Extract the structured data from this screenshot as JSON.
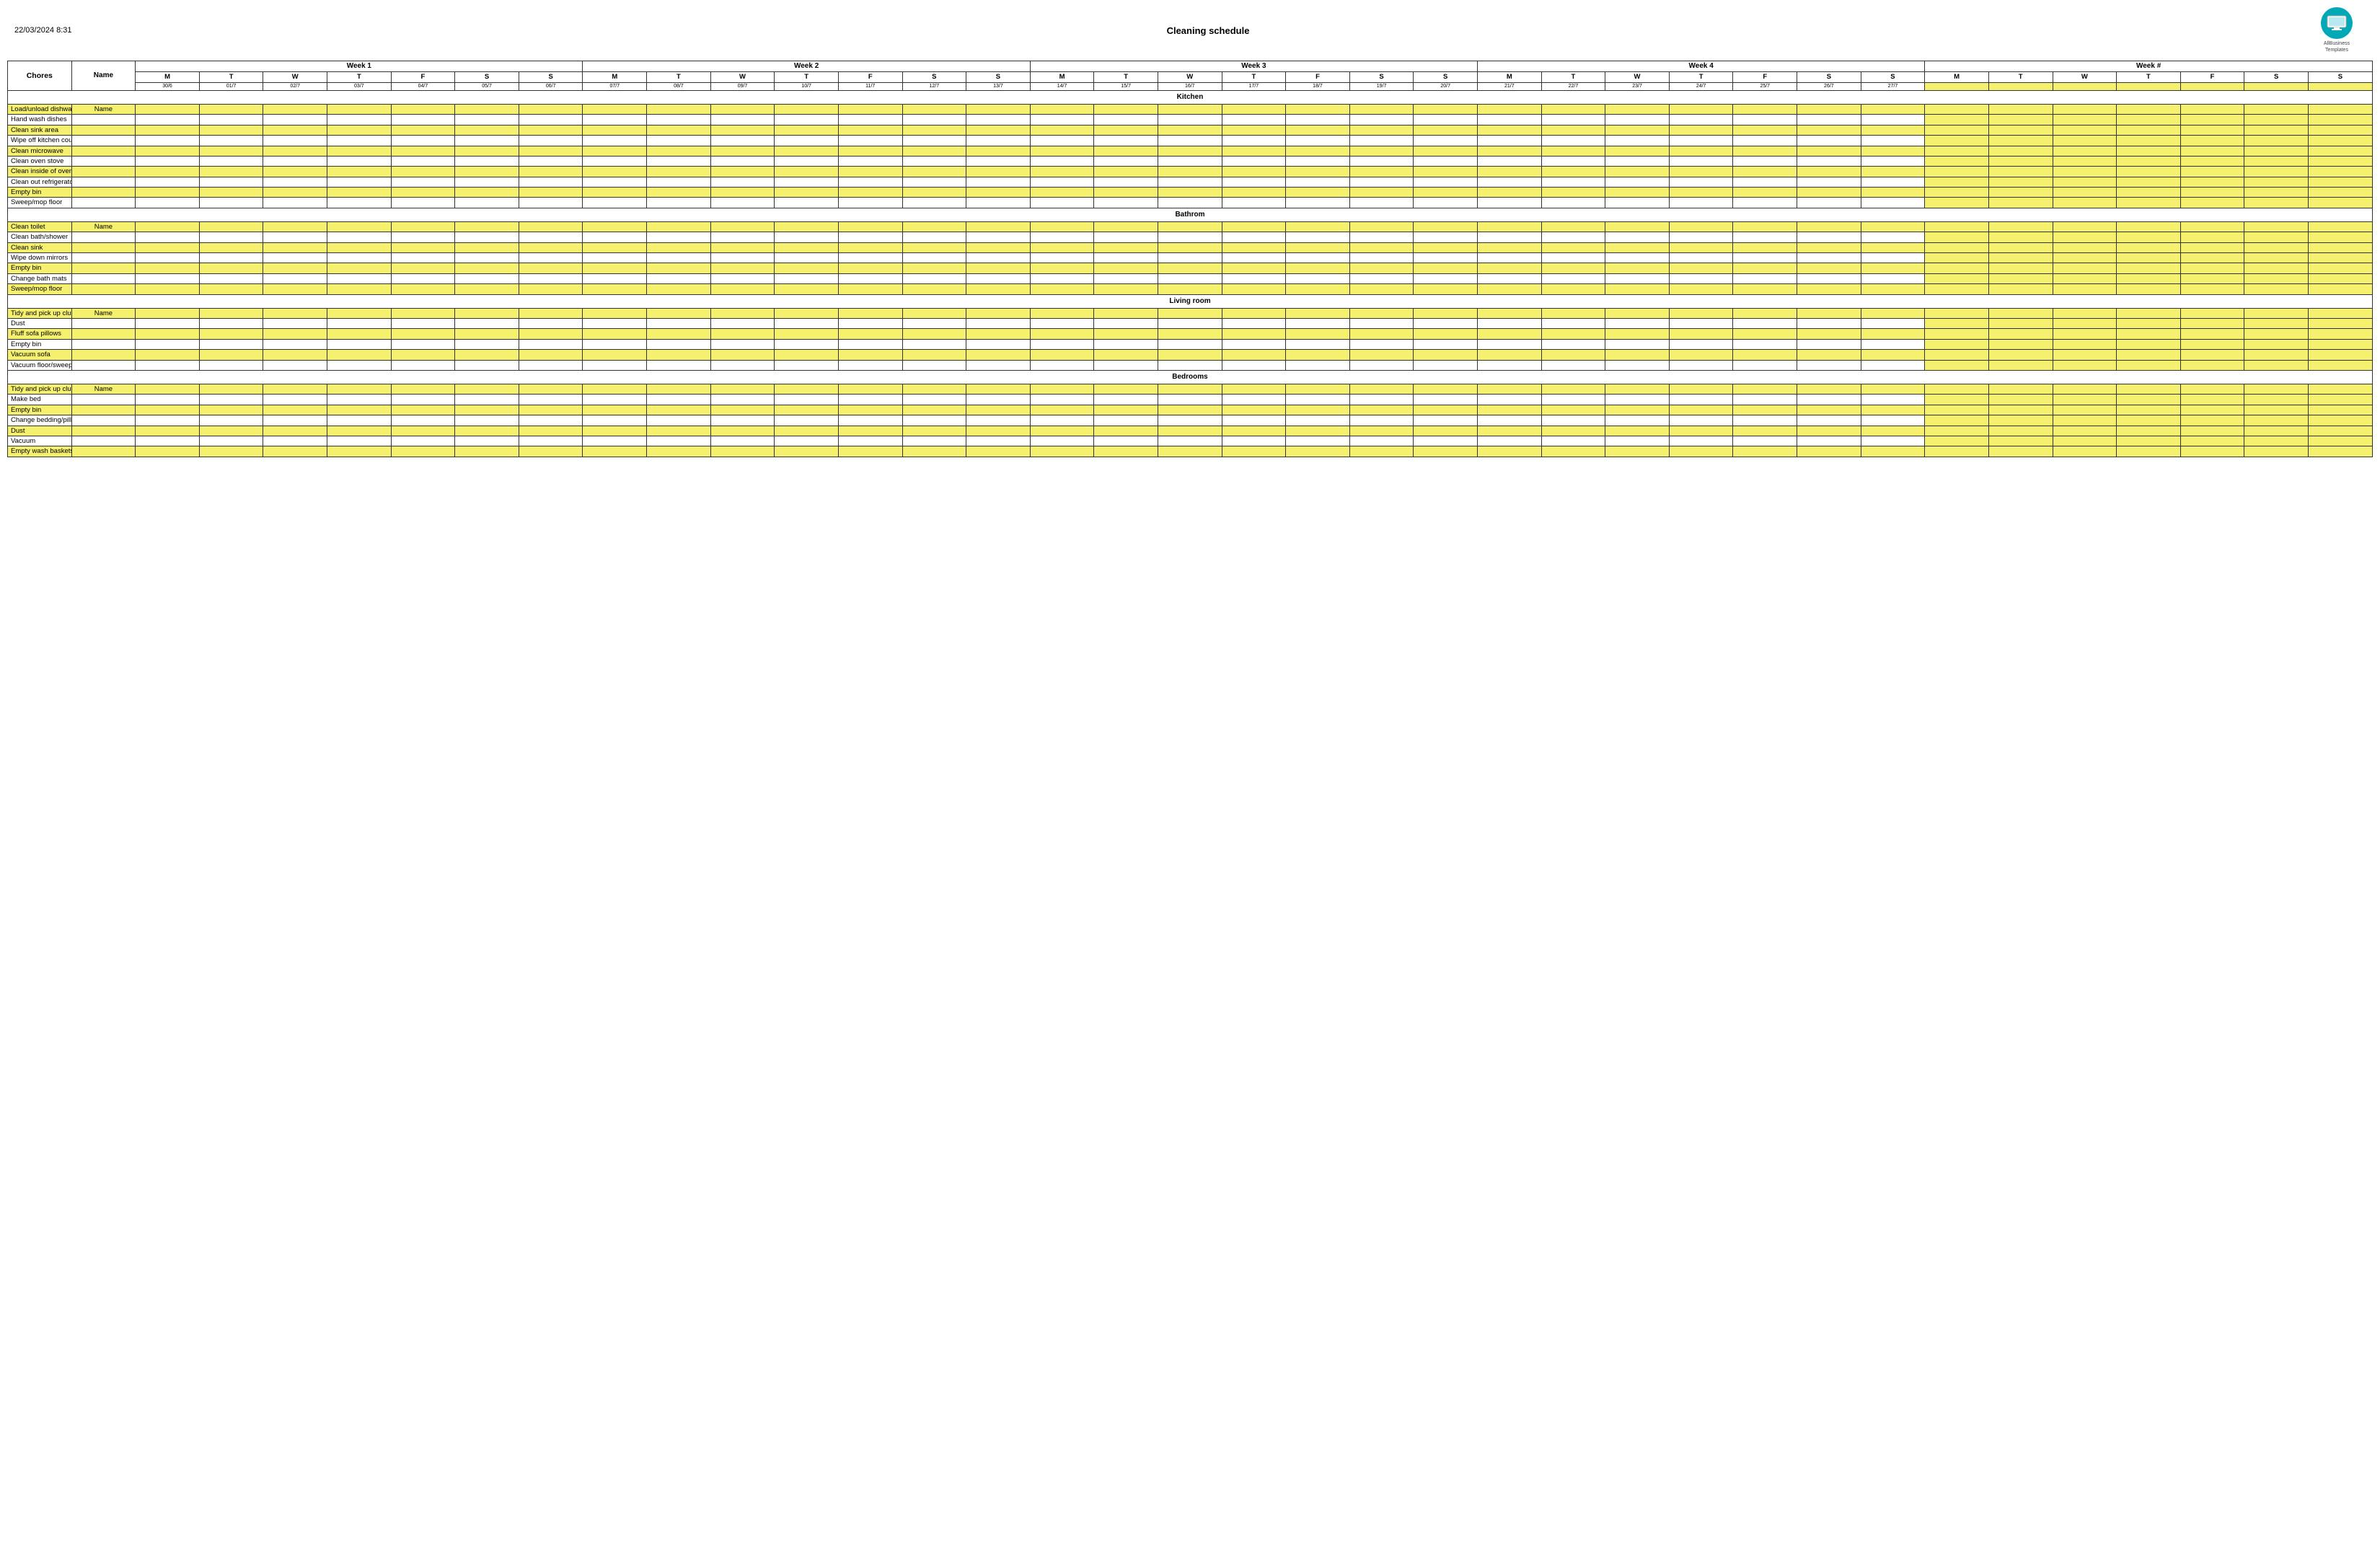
{
  "header": {
    "date": "22/03/2024 8:31",
    "title": "Cleaning schedule",
    "logo_line1": "AllBusiness",
    "logo_line2": "Templates"
  },
  "table": {
    "chores_label": "Chores",
    "name_label": "Name",
    "weeks": [
      {
        "label": "Week 1",
        "span": 7
      },
      {
        "label": "Week 2",
        "span": 7
      },
      {
        "label": "Week 3",
        "span": 7
      },
      {
        "label": "Week 4",
        "span": 7
      },
      {
        "label": "Week #",
        "span": 7
      }
    ],
    "days": [
      "M",
      "T",
      "W",
      "T",
      "F",
      "S",
      "S"
    ],
    "dates": [
      "30/6",
      "01/7",
      "02/7",
      "03/7",
      "04/7",
      "05/7",
      "06/7",
      "07/7",
      "08/7",
      "09/7",
      "10/7",
      "11/7",
      "12/7",
      "13/7",
      "14/7",
      "15/7",
      "16/7",
      "17/7",
      "18/7",
      "19/7",
      "20/7",
      "21/7",
      "22/7",
      "23/7",
      "24/7",
      "25/7",
      "26/7",
      "27/7",
      "",
      "",
      "",
      "",
      "",
      "",
      ""
    ],
    "sections": [
      {
        "name": "Kitchen",
        "rows": [
          {
            "label": "Load/unload dishwasher",
            "has_name": true,
            "yellow": true
          },
          {
            "label": "Hand wash dishes",
            "has_name": false,
            "yellow": false
          },
          {
            "label": "Clean sink area",
            "has_name": false,
            "yellow": true
          },
          {
            "label": "Wipe off kitchen counters",
            "has_name": false,
            "yellow": false
          },
          {
            "label": "Clean microwave",
            "has_name": false,
            "yellow": true
          },
          {
            "label": "Clean oven stove",
            "has_name": false,
            "yellow": false
          },
          {
            "label": "Clean inside of oven",
            "has_name": false,
            "yellow": true
          },
          {
            "label": "Clean out refrigerator",
            "has_name": false,
            "yellow": false
          },
          {
            "label": "Empty bin",
            "has_name": false,
            "yellow": true
          },
          {
            "label": "Sweep/mop floor",
            "has_name": false,
            "yellow": false
          }
        ]
      },
      {
        "name": "Bathrom",
        "rows": [
          {
            "label": "Clean toilet",
            "has_name": true,
            "yellow": true
          },
          {
            "label": "Clean bath/shower",
            "has_name": false,
            "yellow": false
          },
          {
            "label": "Clean sink",
            "has_name": false,
            "yellow": true
          },
          {
            "label": "Wipe down mirrors",
            "has_name": false,
            "yellow": false
          },
          {
            "label": "Empty bin",
            "has_name": false,
            "yellow": true
          },
          {
            "label": "Change bath mats",
            "has_name": false,
            "yellow": false
          },
          {
            "label": "Sweep/mop floor",
            "has_name": false,
            "yellow": true
          }
        ]
      },
      {
        "name": "Living room",
        "rows": [
          {
            "label": "Tidy and pick up clutter",
            "has_name": true,
            "yellow": true
          },
          {
            "label": "Dust",
            "has_name": false,
            "yellow": false
          },
          {
            "label": "Fluff sofa pillows",
            "has_name": false,
            "yellow": true
          },
          {
            "label": "Empty bin",
            "has_name": false,
            "yellow": false
          },
          {
            "label": "Vacuum sofa",
            "has_name": false,
            "yellow": true
          },
          {
            "label": "Vacuum floor/sweep",
            "has_name": false,
            "yellow": false
          }
        ]
      },
      {
        "name": "Bedrooms",
        "rows": [
          {
            "label": "Tidy and pick up clutter",
            "has_name": true,
            "yellow": true
          },
          {
            "label": "Make bed",
            "has_name": false,
            "yellow": false
          },
          {
            "label": "Empty bin",
            "has_name": false,
            "yellow": true
          },
          {
            "label": "Change bedding/pillows",
            "has_name": false,
            "yellow": false
          },
          {
            "label": "Dust",
            "has_name": false,
            "yellow": true
          },
          {
            "label": "Vacuum",
            "has_name": false,
            "yellow": false
          },
          {
            "label": "Empty wash baskets",
            "has_name": false,
            "yellow": true
          }
        ]
      }
    ]
  }
}
